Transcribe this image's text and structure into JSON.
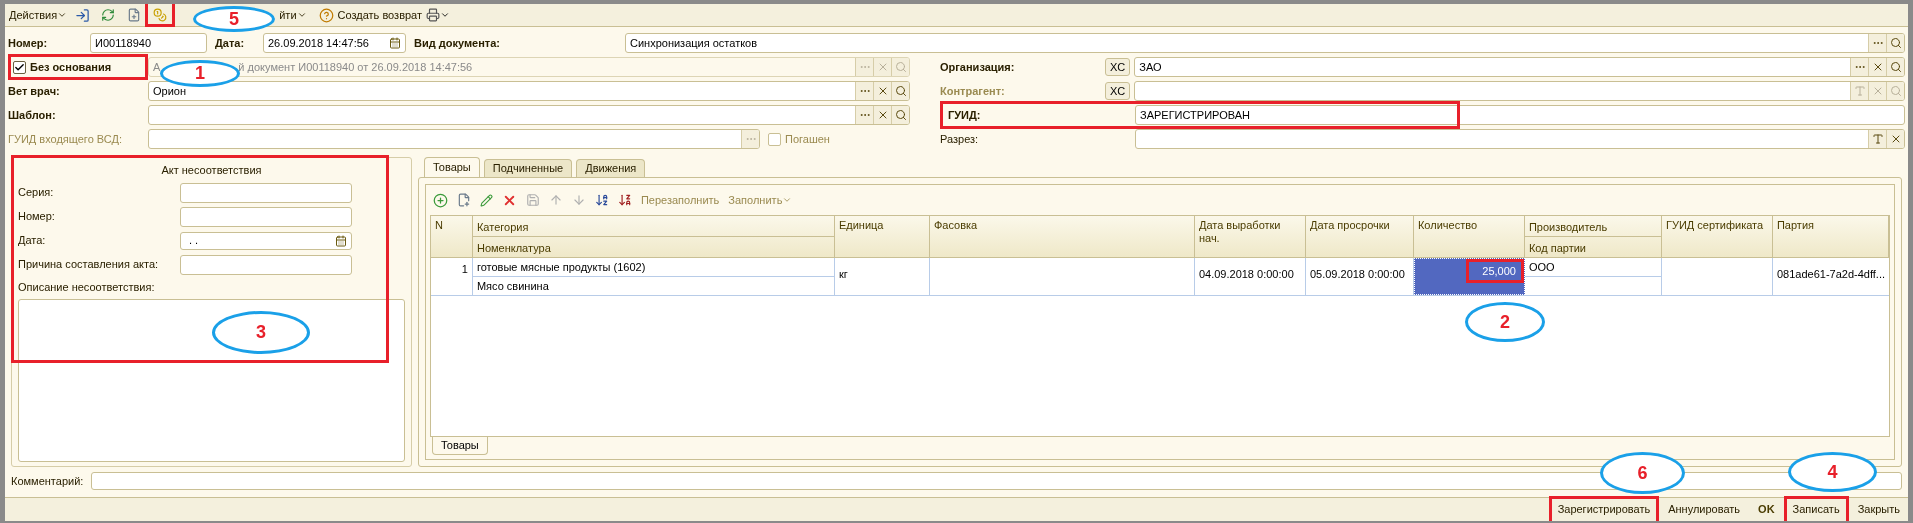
{
  "toolbar": {
    "actions_menu": "Действия",
    "partial_menu": "йти",
    "create_return": "Создать возврат"
  },
  "header": {
    "number": {
      "label": "Номер:",
      "value": "И00118940"
    },
    "date": {
      "label": "Дата:",
      "value": "26.09.2018 14:47:56"
    },
    "doc_type": {
      "label": "Вид документа:",
      "value": "Синхронизация остатков"
    },
    "no_basis": {
      "label": "Без основания",
      "checked": true
    },
    "basis_start": "А",
    "basis_end": "й документ И00118940 от 26.09.2018 14:47:56",
    "vet": {
      "label": "Вет врач:",
      "value": "Орион"
    },
    "template": {
      "label": "Шаблон:"
    },
    "incoming_guid": {
      "label": "ГУИД входящего ВСД:"
    },
    "paid_off": {
      "label": "Погашен",
      "checked": false
    },
    "organization": {
      "label": "Организация:",
      "xc": "XC",
      "value": "ЗАО"
    },
    "counterparty": {
      "label": "Контрагент:",
      "xc": "XC"
    },
    "guid": {
      "label": "ГУИД:",
      "value": "ЗАРЕГИСТРИРОВАН"
    },
    "section": {
      "label": "Разрез:"
    }
  },
  "act": {
    "title": "Акт несоответствия",
    "fields": [
      {
        "label": "Серия:",
        "kind": "text"
      },
      {
        "label": "Номер:",
        "kind": "text"
      },
      {
        "label": "Дата:",
        "kind": "date",
        "value": ". ."
      },
      {
        "label": "Причина составления акта:",
        "kind": "text"
      }
    ],
    "description_label": "Описание несоответствия:"
  },
  "tabs": [
    {
      "label": "Товары",
      "selected": true
    },
    {
      "label": "Подчиненные",
      "selected": false
    },
    {
      "label": "Движения",
      "selected": false
    }
  ],
  "table_toolbar": {
    "refill": "Перезаполнить",
    "fill": "Заполнить"
  },
  "table": {
    "columns": [
      {
        "label": "N"
      },
      {
        "label": "Категория",
        "sub": "Номенклатура"
      },
      {
        "label": "Единица"
      },
      {
        "label": "Фасовка"
      },
      {
        "label": "Дата выработки нач."
      },
      {
        "label": "Дата просрочки"
      },
      {
        "label": "Количество"
      },
      {
        "label": "Производитель",
        "sub": "Код партии"
      },
      {
        "label": "ГУИД сертификата"
      },
      {
        "label": "Партия"
      }
    ],
    "rows": [
      {
        "n": "1",
        "category": "готовые мясные продукты (1602)",
        "nomenclature": "Мясо свинина",
        "unit": "кг",
        "date_made": "04.09.2018 0:00:00",
        "date_expiry": "05.09.2018 0:00:00",
        "quantity": "25,000",
        "quantity_selected": true,
        "producer": "ООО",
        "batch": "081ade61-7a2d-4dff..."
      }
    ]
  },
  "bottom_tabs": [
    {
      "label": "Товары",
      "selected": true
    }
  ],
  "comment": {
    "label": "Комментарий:"
  },
  "footer_buttons": [
    {
      "label": "Зарегистрировать",
      "kind": "button"
    },
    {
      "label": "Аннулировать",
      "kind": "button"
    },
    {
      "label": "OK",
      "kind": "default"
    },
    {
      "label": "Записать",
      "kind": "button"
    },
    {
      "label": "Закрыть",
      "kind": "button"
    }
  ],
  "callouts": [
    {
      "number": "5"
    },
    {
      "number": "1"
    },
    {
      "number": "3"
    },
    {
      "number": "2"
    },
    {
      "number": "6"
    },
    {
      "number": "4"
    }
  ]
}
